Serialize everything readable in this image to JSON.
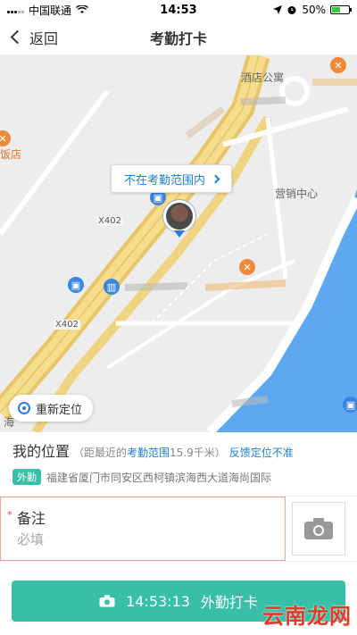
{
  "status_bar": {
    "carrier": "中国联通",
    "time": "14:53",
    "battery": "50%",
    "battery_level": 0.5
  },
  "nav": {
    "back_label": "返回",
    "title": "考勤打卡"
  },
  "map": {
    "range_tip": "不在考勤范围内",
    "labels": {
      "hotel_apartment": "酒店公寓",
      "sales_center": "营销中心",
      "restaurant_partial": "饭店",
      "road_a": "X402",
      "road_b": "X402",
      "partial_left": "海"
    },
    "relocate_label": "重新定位"
  },
  "location": {
    "title": "我的位置",
    "distance_prefix": "（距最近的",
    "range_link": "考勤范围",
    "distance_value": "15.9千米）",
    "feedback_link": "反馈定位不准",
    "badge": "外勤",
    "address": "福建省厦门市同安区西柯镇滨海西大道海尚国际"
  },
  "remark": {
    "required_mark": "*",
    "label": "备注",
    "placeholder": "必填"
  },
  "checkin": {
    "time": "14:53:13",
    "label": "外勤打卡"
  },
  "watermark": "云南龙网",
  "icons": {
    "back": "chevron-left-icon",
    "wifi": "wifi-icon",
    "camera": "camera-icon",
    "relocate": "location-target-icon"
  },
  "colors": {
    "accent": "#38bfa8",
    "link": "#1e7fd6",
    "required": "#e64545",
    "water": "#5ea8f0"
  }
}
